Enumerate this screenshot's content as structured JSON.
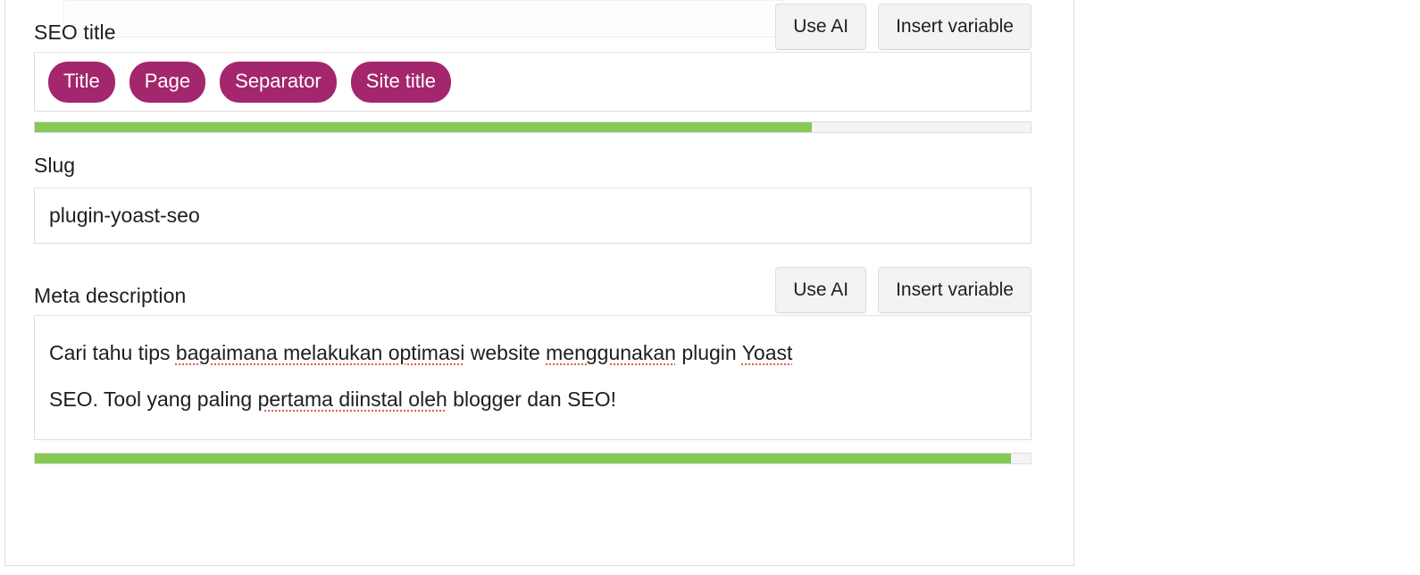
{
  "panel": {
    "seo_title": {
      "label": "SEO title",
      "use_ai_label": "Use AI",
      "insert_variable_label": "Insert variable",
      "variables": [
        "Title",
        "Page",
        "Separator",
        "Site title"
      ],
      "progress_percent": 78
    },
    "slug": {
      "label": "Slug",
      "value": "plugin-yoast-seo"
    },
    "meta_description": {
      "label": "Meta description",
      "use_ai_label": "Use AI",
      "insert_variable_label": "Insert variable",
      "value": "Cari tahu tips bagaimana melakukan optimasi website menggunakan plugin Yoast SEO. Tool yang paling pertama diinstal oleh blogger dan SEO!",
      "line1": {
        "t1": "Cari tahu tips ",
        "s1": "bagaimana melakukan optimasi",
        "t2": " website ",
        "s2": "menggunakan",
        "t3": " plugin ",
        "s3": "Yoast"
      },
      "line2": {
        "t1": "SEO. Tool yang paling ",
        "s1": "pertama diinstal oleh",
        "t2": " blogger dan SEO!"
      },
      "progress_percent": 98
    },
    "colors": {
      "pill": "#a4266c",
      "progress_fill": "#86c955",
      "progress_track": "#f4f4f4",
      "border": "#dcdcde",
      "text": "#1e1e1e",
      "spellcheck": "#e8584a"
    }
  }
}
